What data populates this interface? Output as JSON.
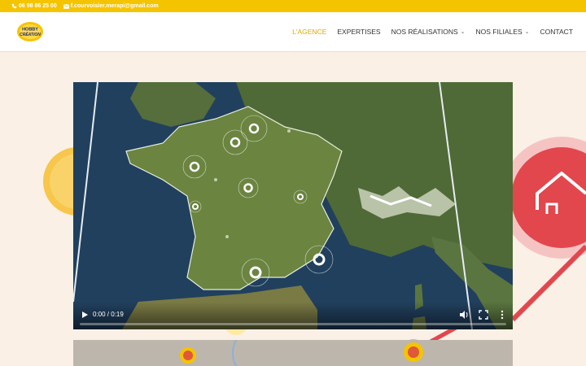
{
  "topbar": {
    "phone": "06 98 86 25 00",
    "email": "f.courvoisier.merapi@gmail.com"
  },
  "logo": {
    "line1": "HOBBY",
    "line2": "CRÉATION"
  },
  "nav": {
    "items": [
      {
        "label": "L'AGENCE",
        "active": true,
        "dropdown": false
      },
      {
        "label": "EXPERTISES",
        "active": false,
        "dropdown": false
      },
      {
        "label": "NOS RÉALISATIONS",
        "active": false,
        "dropdown": true
      },
      {
        "label": "NOS FILIALES",
        "active": false,
        "dropdown": true
      },
      {
        "label": "CONTACT",
        "active": false,
        "dropdown": false
      }
    ]
  },
  "video": {
    "time": "0:00 / 0:19",
    "progress": 0
  },
  "colors": {
    "accent": "#f5c400",
    "active_nav": "#e0a800",
    "background": "#faf0e6",
    "pin_red": "#e2474d"
  }
}
